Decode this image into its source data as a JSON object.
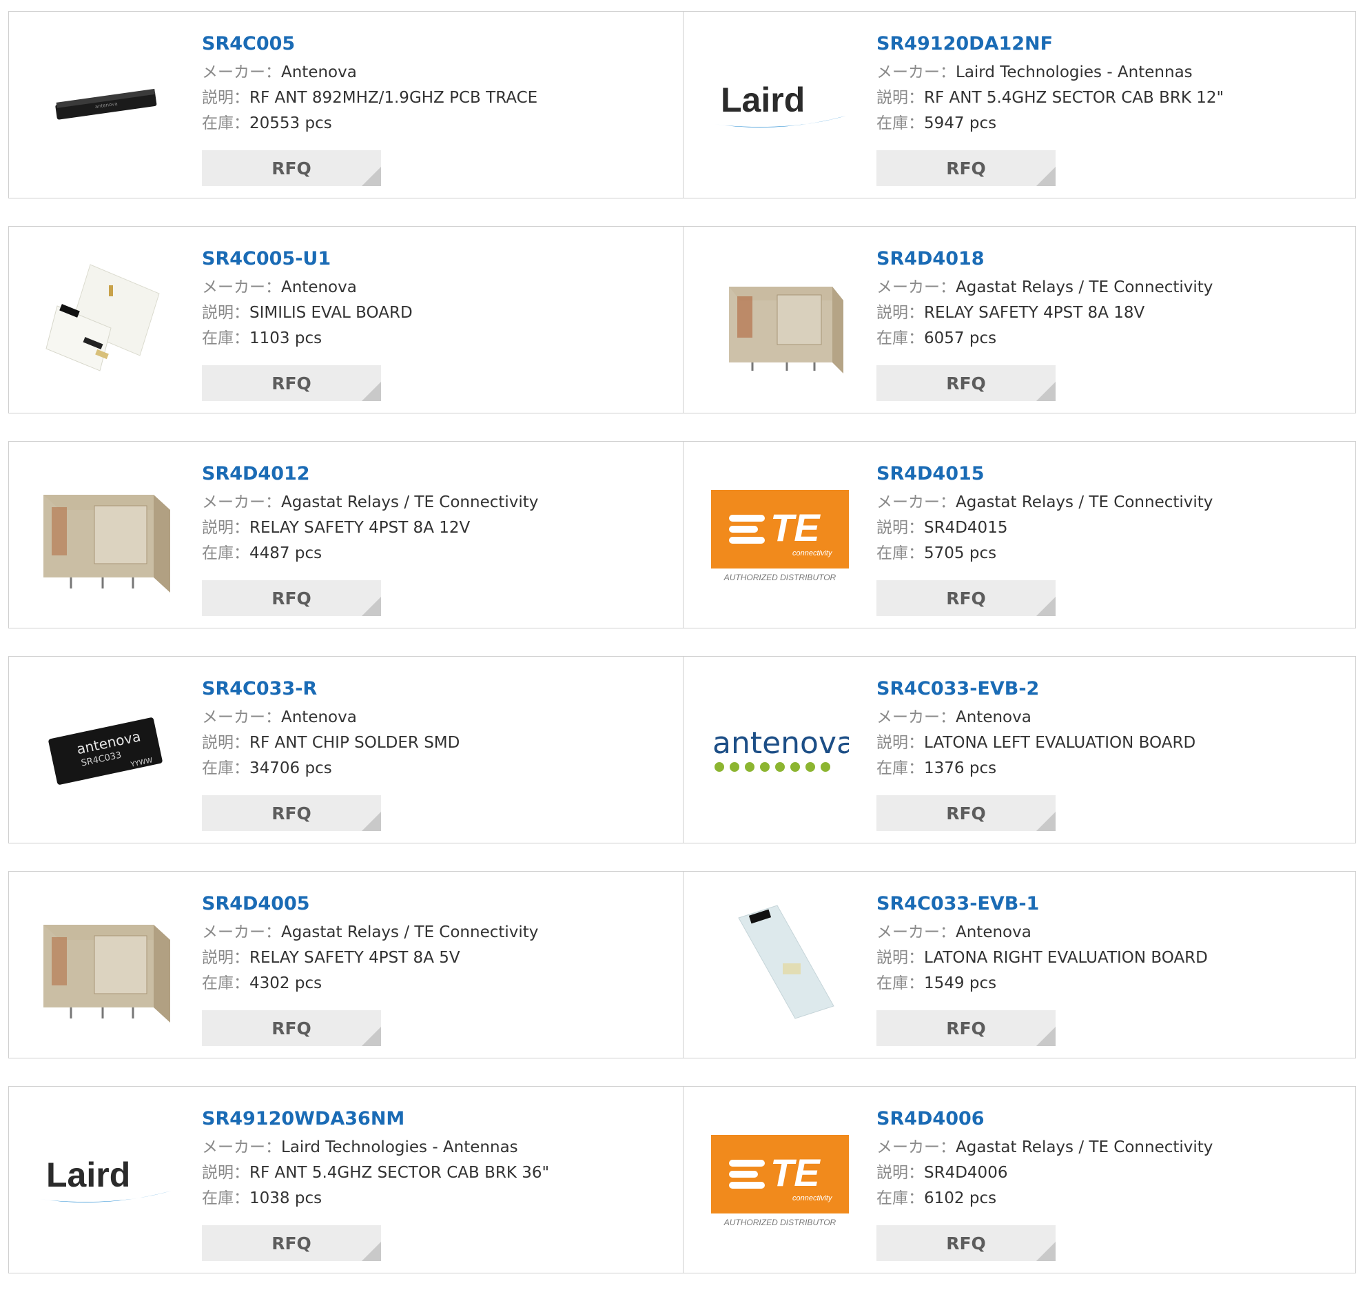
{
  "labels": {
    "maker": "メーカー：",
    "desc": "説明：",
    "stock": "在庫：",
    "rfq": "RFQ"
  },
  "products": [
    {
      "pn": "SR4C005",
      "maker": "Antenova",
      "desc": "RF ANT 892MHZ/1.9GHZ PCB TRACE",
      "stock": "20553 pcs",
      "img": "antenna-pcb"
    },
    {
      "pn": "SR49120DA12NF",
      "maker": "Laird Technologies - Antennas",
      "desc": "RF ANT 5.4GHZ SECTOR CAB BRK 12\"",
      "stock": "5947 pcs",
      "img": "laird-logo"
    },
    {
      "pn": "SR4C005-U1",
      "maker": "Antenova",
      "desc": "SIMILIS EVAL BOARD",
      "stock": "1103 pcs",
      "img": "eval-board-white"
    },
    {
      "pn": "SR4D4018",
      "maker": "Agastat Relays / TE Connectivity",
      "desc": "RELAY SAFETY 4PST 8A 18V",
      "stock": "6057 pcs",
      "img": "relay-small"
    },
    {
      "pn": "SR4D4012",
      "maker": "Agastat Relays / TE Connectivity",
      "desc": "RELAY SAFETY 4PST 8A 12V",
      "stock": "4487 pcs",
      "img": "relay-large"
    },
    {
      "pn": "SR4D4015",
      "maker": "Agastat Relays / TE Connectivity",
      "desc": "SR4D4015",
      "stock": "5705 pcs",
      "img": "te-logo"
    },
    {
      "pn": "SR4C033-R",
      "maker": "Antenova",
      "desc": "RF ANT CHIP SOLDER SMD",
      "stock": "34706 pcs",
      "img": "chip-antenova"
    },
    {
      "pn": "SR4C033-EVB-2",
      "maker": "Antenova",
      "desc": "LATONA LEFT EVALUATION BOARD",
      "stock": "1376 pcs",
      "img": "antenova-logo"
    },
    {
      "pn": "SR4D4005",
      "maker": "Agastat Relays / TE Connectivity",
      "desc": "RELAY SAFETY 4PST 8A 5V",
      "stock": "4302 pcs",
      "img": "relay-large"
    },
    {
      "pn": "SR4C033-EVB-1",
      "maker": "Antenova",
      "desc": "LATONA RIGHT EVALUATION BOARD",
      "stock": "1549 pcs",
      "img": "eval-board-blue"
    },
    {
      "pn": "SR49120WDA36NM",
      "maker": "Laird Technologies - Antennas",
      "desc": "RF ANT 5.4GHZ SECTOR CAB BRK 36\"",
      "stock": "1038 pcs",
      "img": "laird-logo"
    },
    {
      "pn": "SR4D4006",
      "maker": "Agastat Relays / TE Connectivity",
      "desc": "SR4D4006",
      "stock": "6102 pcs",
      "img": "te-logo"
    }
  ],
  "logos": {
    "laird": "Laird",
    "te": "TE",
    "te_sub": "connectivity",
    "te_dist": "AUTHORIZED DISTRIBUTOR",
    "antenova": "antenova",
    "chip_text": "antenova",
    "chip_code": "SR4C033",
    "chip_date": "YYWW"
  },
  "colors": {
    "link": "#1a6bb5",
    "te_orange": "#f18a1c",
    "antenova_green": "#8cb531",
    "laird_blue": "#1e88d1"
  }
}
